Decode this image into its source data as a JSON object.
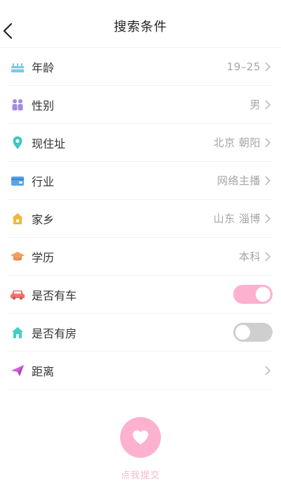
{
  "header": {
    "title": "搜索条件"
  },
  "rows": [
    {
      "label": "年龄",
      "value": "19–25",
      "icon": "cake-icon"
    },
    {
      "label": "性别",
      "value": "男",
      "icon": "people-icon"
    },
    {
      "label": "现住址",
      "value": "北京 朝阳",
      "icon": "location-pin-icon"
    },
    {
      "label": "行业",
      "value": "网络主播",
      "icon": "wallet-icon"
    },
    {
      "label": "家乡",
      "value": "山东 淄博",
      "icon": "home-icon"
    },
    {
      "label": "学历",
      "value": "本科",
      "icon": "graduation-cap-icon"
    },
    {
      "label": "是否有车",
      "value": "",
      "icon": "car-icon",
      "toggle": true
    },
    {
      "label": "是否有房",
      "value": "",
      "icon": "house-icon",
      "toggle": false
    },
    {
      "label": "距离",
      "value": "",
      "icon": "paper-plane-icon"
    }
  ],
  "submit": {
    "label": "点我提交",
    "icon": "heart-icon"
  },
  "colors": {
    "accent": "#fcb1cf",
    "toggle_off": "#cfcfcf",
    "secondary_text": "#a6a6a6"
  }
}
